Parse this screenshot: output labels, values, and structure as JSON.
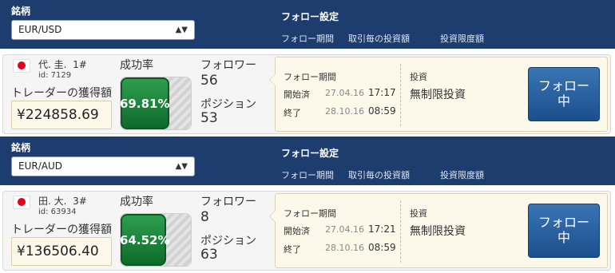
{
  "rows": [
    {
      "header": {
        "symbol_label": "銘柄",
        "selected_symbol": "EUR/USD",
        "follow_settings": "フォロー設定",
        "col_period": "フォロー期間",
        "col_amount": "取引毎の投資額",
        "col_limit": "投資限度額"
      },
      "trader": {
        "name": "代. 圭.",
        "rank": "1#",
        "id": "id: 7129",
        "gain_label": "トレーダーの獲得額",
        "gain_value": "¥224858.69",
        "success_label": "成功率",
        "success_value": "69.81%",
        "success_fraction": 0.6981,
        "followers_label": "フォロワー",
        "followers_value": "56",
        "positions_label": "ポジション",
        "positions_value": "53"
      },
      "follow_info": {
        "period_title": "フォロー期間",
        "start_label": "開始済",
        "start_date": "27.04.16",
        "start_time": "17:17",
        "end_label": "終了",
        "end_date": "28.10.16",
        "end_time": "08:59",
        "investment_label": "投資",
        "investment_value": "無制限投資",
        "button_line1": "フォロー",
        "button_line2": "中"
      }
    },
    {
      "header": {
        "symbol_label": "銘柄",
        "selected_symbol": "EUR/AUD",
        "follow_settings": "フォロー設定",
        "col_period": "フォロー期間",
        "col_amount": "取引毎の投資額",
        "col_limit": "投資限度額"
      },
      "trader": {
        "name": "田. 大.",
        "rank": "3#",
        "id": "id: 63934",
        "gain_label": "トレーダーの獲得額",
        "gain_value": "¥136506.40",
        "success_label": "成功率",
        "success_value": "64.52%",
        "success_fraction": 0.6452,
        "followers_label": "フォロワー",
        "followers_value": "8",
        "positions_label": "ポジション",
        "positions_value": "63"
      },
      "follow_info": {
        "period_title": "フォロー期間",
        "start_label": "開始済",
        "start_date": "27.04.16",
        "start_time": "17:21",
        "end_label": "終了",
        "end_date": "28.10.16",
        "end_time": "08:59",
        "investment_label": "投資",
        "investment_value": "無制限投資",
        "button_line1": "フォロー",
        "button_line2": "中"
      }
    }
  ],
  "icons": {
    "flag": "japan-flag-icon",
    "select_caret": "up-down-caret-icon"
  },
  "colors": {
    "header_bg": "#1c3d6e",
    "success_green": "#137a33",
    "button_blue": "#2a62a0",
    "info_bg": "#fdf9ea"
  }
}
